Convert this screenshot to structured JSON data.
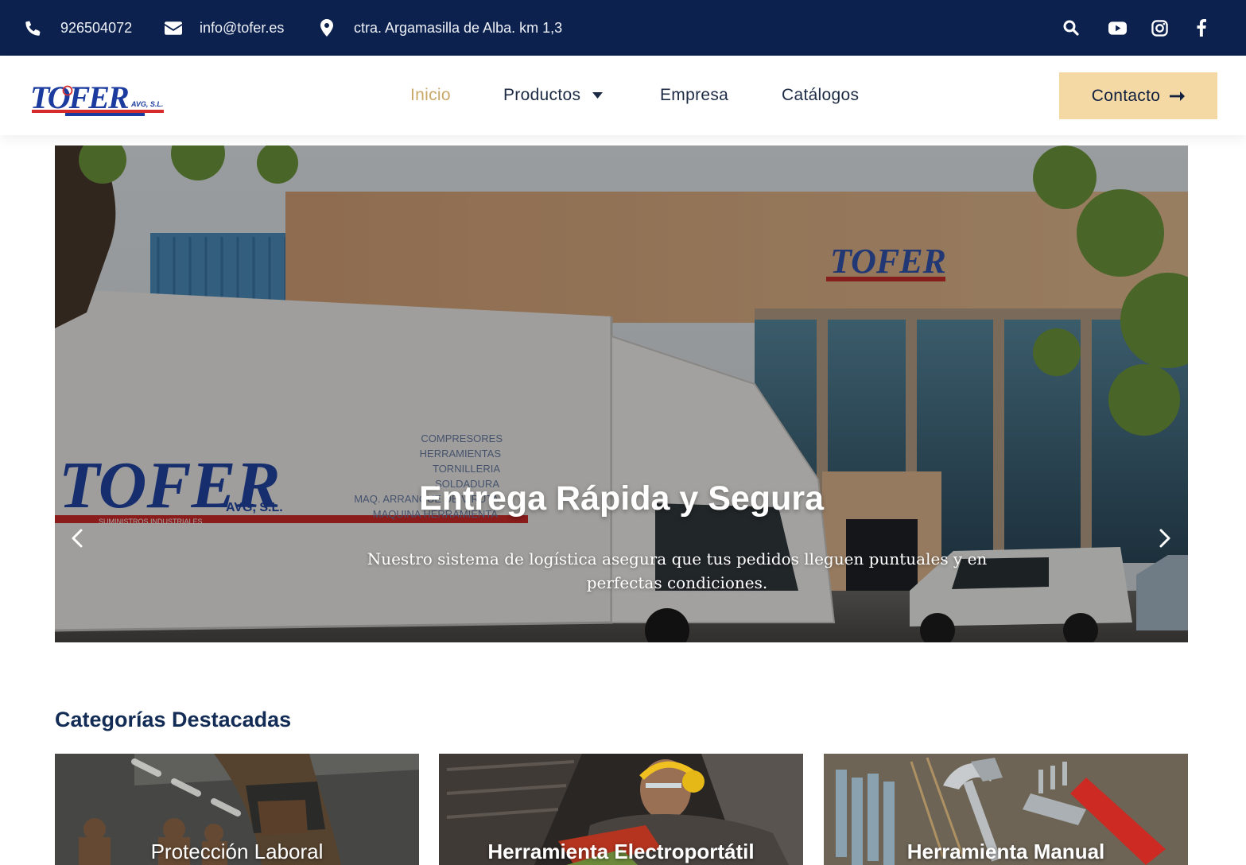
{
  "topbar": {
    "phone": "926504072",
    "email": "info@tofer.es",
    "address": "ctra. Argamasilla de Alba. km 1,3",
    "social_icons": [
      "search-icon",
      "youtube-icon",
      "instagram-icon",
      "facebook-icon"
    ]
  },
  "header": {
    "logo_text": "TOFER",
    "logo_sub": "AVG, S.L.",
    "logo_tag": "SUMINISTROS INDUSTRIALES",
    "nav": {
      "inicio": "Inicio",
      "productos": "Productos",
      "empresa": "Empresa",
      "catalogos": "Catálogos"
    },
    "contact_label": "Contacto"
  },
  "hero": {
    "title": "Entrega Rápida y Segura",
    "text": "Nuestro sistema de logística asegura que tus pedidos lleguen puntuales y en perfectas condiciones.",
    "slide_count": 4,
    "active_slide": 3,
    "truck_list": [
      "COMPRESORES",
      "HERRAMIENTAS",
      "TORNILLERIA",
      "SOLDADURA",
      "MAQ. ARRANQUE DE VIRUTA",
      "MAQUINA HERRAMIENTA"
    ],
    "truck_brand": "TOFER",
    "truck_sub": "AVG, S.L.",
    "truck_tag": "SUMINISTROS INDUSTRIALES"
  },
  "categories": {
    "title": "Categorías Destacadas",
    "items": [
      {
        "label": "Protección Laboral"
      },
      {
        "label": "Herramienta Electroportátil"
      },
      {
        "label": "Herramienta Manual"
      }
    ]
  },
  "colors": {
    "topbar_bg": "#0c214e",
    "accent": "#c9a86a",
    "button_bg": "#f5d9a4",
    "heading": "#132c55"
  }
}
